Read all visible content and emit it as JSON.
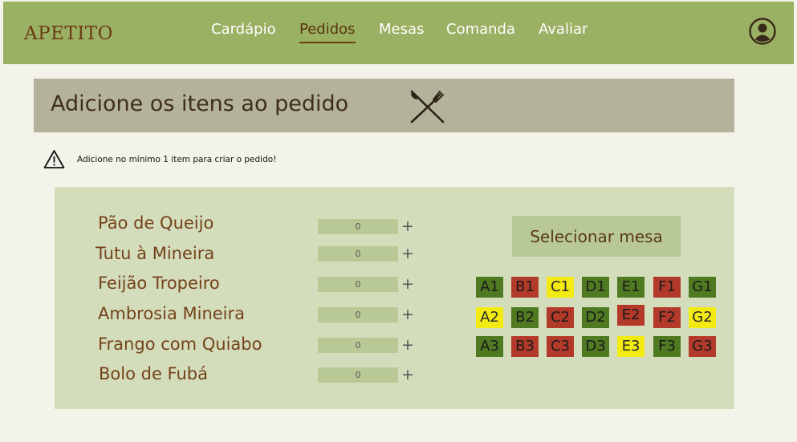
{
  "header": {
    "logo": "APETITO",
    "nav": [
      "Cardápio",
      "Pedidos",
      "Mesas",
      "Comanda",
      "Avaliar"
    ],
    "active_nav": "Pedidos"
  },
  "page_title": "Adicione os itens ao pedido",
  "warning": "Adicione no mínimo 1 item para criar o pedido!",
  "items": [
    {
      "name": "Pão de Queijo",
      "qty": "0"
    },
    {
      "name": "Tutu à Mineira",
      "qty": "0"
    },
    {
      "name": "Feijão Tropeiro",
      "qty": "0"
    },
    {
      "name": "Ambrosia Mineira",
      "qty": "0"
    },
    {
      "name": "Frango com Quiabo",
      "qty": "0"
    },
    {
      "name": "Bolo de Fubá",
      "qty": "0"
    }
  ],
  "plus_symbol": "+",
  "select_table_label": "Selecionar mesa",
  "status_colors": {
    "available": "#4f7a22",
    "occupied": "#b33a2a",
    "reserved": "#f2ea10"
  },
  "tables": [
    [
      {
        "id": "A1",
        "status": "available"
      },
      {
        "id": "B1",
        "status": "occupied"
      },
      {
        "id": "C1",
        "status": "reserved"
      },
      {
        "id": "D1",
        "status": "available"
      },
      {
        "id": "E1",
        "status": "available"
      },
      {
        "id": "F1",
        "status": "occupied"
      },
      {
        "id": "G1",
        "status": "available"
      }
    ],
    [
      {
        "id": "A2",
        "status": "reserved"
      },
      {
        "id": "B2",
        "status": "available"
      },
      {
        "id": "C2",
        "status": "occupied"
      },
      {
        "id": "D2",
        "status": "available"
      },
      {
        "id": "E2",
        "status": "occupied"
      },
      {
        "id": "F2",
        "status": "occupied"
      },
      {
        "id": "G2",
        "status": "reserved"
      }
    ],
    [
      {
        "id": "A3",
        "status": "available"
      },
      {
        "id": "B3",
        "status": "occupied"
      },
      {
        "id": "C3",
        "status": "occupied"
      },
      {
        "id": "D3",
        "status": "available"
      },
      {
        "id": "E3",
        "status": "reserved"
      },
      {
        "id": "F3",
        "status": "available"
      },
      {
        "id": "G3",
        "status": "occupied"
      }
    ]
  ],
  "icons": {
    "avatar": "user-avatar-icon",
    "title": "fork-knife-icon",
    "warning": "warning-triangle-icon"
  }
}
